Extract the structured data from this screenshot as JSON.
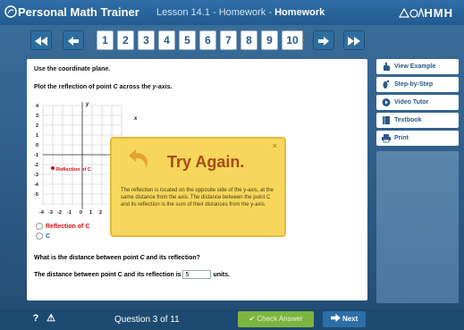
{
  "header": {
    "brand": "Personal Math Trainer",
    "lesson_prefix": "Lesson 14.1 - Homework - ",
    "lesson_bold": "Homework",
    "publisher": "HMH"
  },
  "nav": {
    "pages": [
      "1",
      "2",
      "3",
      "4",
      "5",
      "6",
      "7",
      "8",
      "9",
      "10"
    ],
    "current_page": "3"
  },
  "question": {
    "instruction": "Use the coordinate plane.",
    "prompt_pre": "Plot the reflection of point ",
    "prompt_point": "C",
    "prompt_mid": " across the ",
    "prompt_axis": "y",
    "prompt_post": "-axis.",
    "graph": {
      "y_label": "y",
      "x_label": "x",
      "y_ticks": [
        "4",
        "3",
        "2",
        "1",
        "0",
        "-1",
        "-2",
        "-3",
        "-4",
        "-5"
      ],
      "x_ticks": [
        "-4",
        "-3",
        "-2",
        "-1",
        "0",
        "1",
        "2"
      ],
      "point_label": "Reflection of C"
    },
    "options": [
      "Reflection of C",
      "C"
    ],
    "q2_pre": "What is the distance between point ",
    "q2_point": "C",
    "q2_post": " and its reflection?",
    "answer_pre": "The distance between point C and its reflection is",
    "answer_value": "5",
    "answer_post": "units."
  },
  "popup": {
    "close": "×",
    "title": "Try Again.",
    "message": "The reflection is located on the opposite side of the y-axis, at the same distance from the axis. The distance between the point C and its reflection is the sum of their distances from the y-axis."
  },
  "sidebar": {
    "items": [
      "View Example",
      "Step-by-Step",
      "Video Tutor",
      "Textbook",
      "Print"
    ]
  },
  "footer": {
    "help": "?",
    "warning": "⚠",
    "question_count": "Question 3 of 11",
    "check": "Check Answer",
    "next": "Next"
  },
  "colors": {
    "brand_blue": "#2b5a85",
    "popup_yellow": "#f6d75c",
    "check_green": "#7db440",
    "point_red": "#d01010"
  }
}
